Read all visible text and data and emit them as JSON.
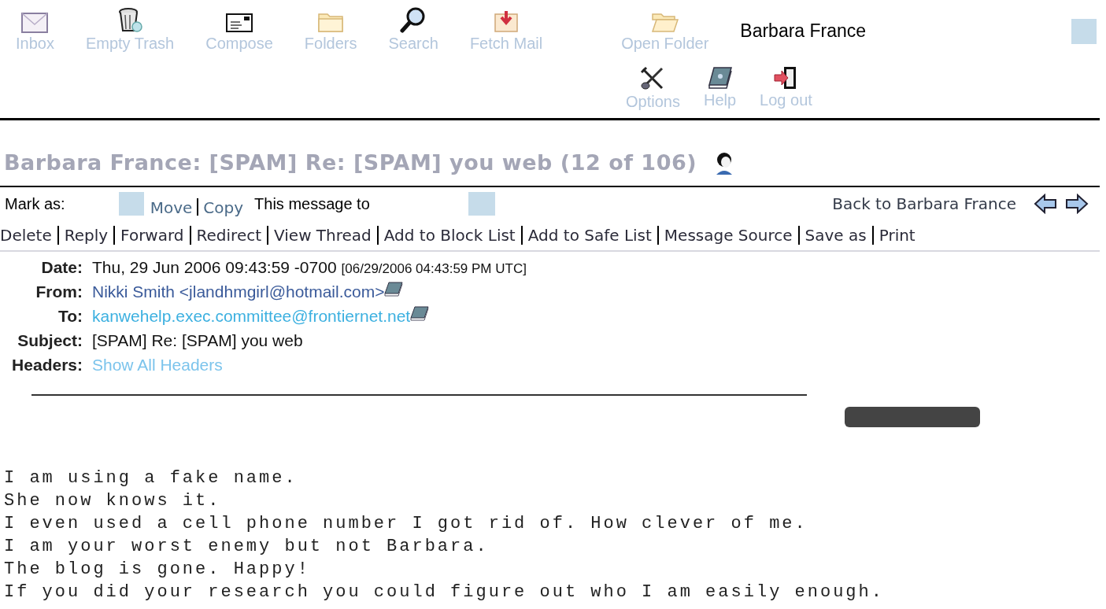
{
  "toolbar": {
    "items": [
      {
        "label": "Inbox",
        "kind": "envelope"
      },
      {
        "label": "Empty Trash",
        "kind": "trash"
      },
      {
        "label": "Compose",
        "kind": "letter"
      },
      {
        "label": "Folders",
        "kind": "folder"
      },
      {
        "label": "Search",
        "kind": "magnifier"
      },
      {
        "label": "Fetch Mail",
        "kind": "fetch"
      },
      {
        "label": "Open Folder",
        "kind": "open-folder"
      }
    ],
    "user": "Barbara France",
    "secondary": [
      {
        "label": "Options",
        "kind": "tools"
      },
      {
        "label": "Help",
        "kind": "book"
      },
      {
        "label": "Log out",
        "kind": "exit"
      }
    ]
  },
  "title": "Barbara France: [SPAM] Re: [SPAM] you web (12 of 106)",
  "message_bar": {
    "mark_as": "Mark as:",
    "move": "Move",
    "copy": "Copy",
    "message_to": "This message to",
    "back": "Back to Barbara France"
  },
  "actions": [
    "Delete",
    "Reply",
    "Forward",
    "Redirect",
    "View Thread",
    "Add to Block List",
    "Add to Safe List",
    "Message Source",
    "Save as",
    "Print"
  ],
  "headers": [
    {
      "label": "Date:",
      "kind": "date",
      "value": "Thu, 29 Jun 2006 09:43:59 -0700",
      "note": "[06/29/2006 04:43:59 PM UTC]"
    },
    {
      "label": "From:",
      "kind": "sender",
      "value": "Nikki Smith <jlandhmgirl@hotmail.com>"
    },
    {
      "label": "To:",
      "kind": "recipient",
      "value": "kanwehelp.exec.committee@frontiernet.net"
    },
    {
      "label": "Subject:",
      "kind": "text",
      "value": "[SPAM] Re: [SPAM] you web"
    },
    {
      "label": "Headers:",
      "kind": "link",
      "value": "Show All Headers"
    }
  ],
  "body": [
    "I am using a fake name.",
    "She now knows it.",
    "I even used a cell phone number I got rid of. How clever of me.",
    "I am your worst enemy but not Barbara.",
    "The blog is gone. Happy!",
    "If you did your research you could figure out who I am easily enough."
  ]
}
